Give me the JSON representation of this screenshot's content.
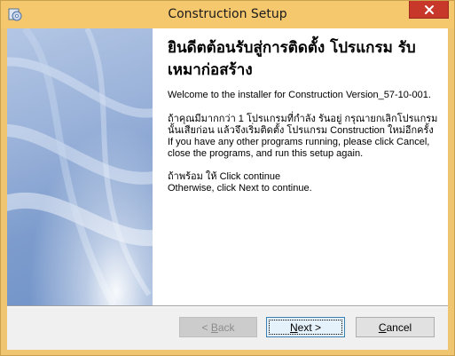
{
  "window": {
    "title": "Construction Setup",
    "app_icon": "setup-disc-icon",
    "close_icon": "close-x-icon"
  },
  "welcome": {
    "heading": "ยินดีตต้อนรับสู่การติดตั้ง โปรแกรม รับเหมาก่อสร้าง",
    "intro": "Welcome to the installer for Construction Version_57-10-001.",
    "paragraph_lines": [
      "ถ้าคุณมีมากกว่า 1 โปรแกรมที่กำลัง รันอยู่ กรุณายกเลิกโปรแกรม",
      "นั้นเสียก่อน แล้วจึงเริ่มติดตั้ง โปรแกรม Construction ใหม่อีกครั้ง",
      "If you have any other programs running, please click Cancel,",
      "close the programs, and run this setup again."
    ],
    "continue_lines": [
      "ถ้าพร้อม ให้ Click continue",
      "Otherwise, click Next to continue."
    ]
  },
  "buttons": {
    "back": {
      "mnemonic": "B",
      "before": "< ",
      "after": "ack"
    },
    "next": {
      "mnemonic": "N",
      "before": "",
      "after": "ext >"
    },
    "cancel": {
      "mnemonic": "C",
      "before": "",
      "after": "ancel"
    }
  },
  "colors": {
    "titlebar": "#f6c86e",
    "close_button": "#c7382a",
    "banner_blue": "#7d9ccd"
  }
}
